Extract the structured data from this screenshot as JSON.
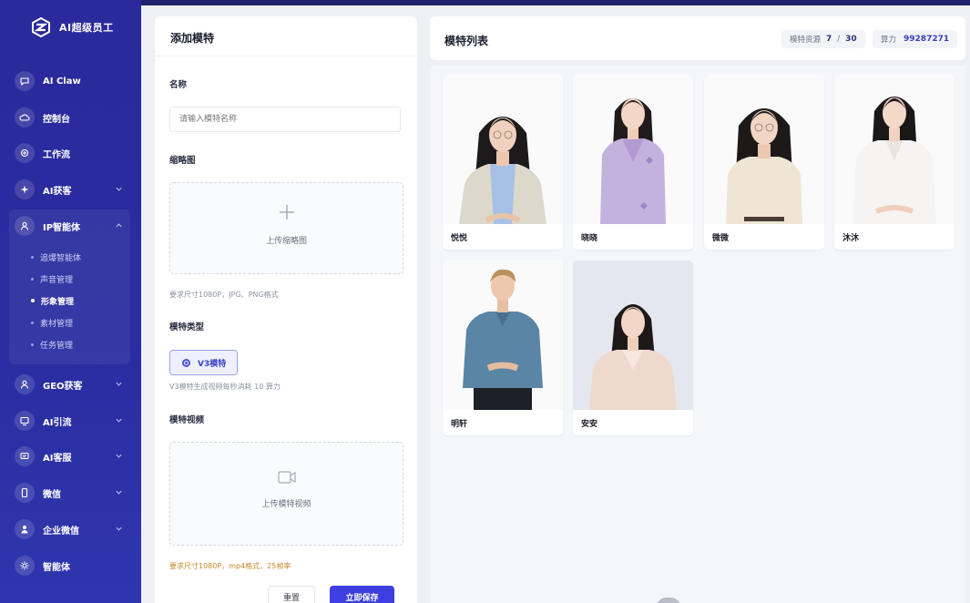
{
  "app": {
    "brand": "AI超级员工"
  },
  "sidebar": {
    "items": [
      {
        "label": "AI Claw",
        "icon": "chat-icon"
      },
      {
        "label": "控制台",
        "icon": "cloud-icon"
      },
      {
        "label": "工作流",
        "icon": "workflow-icon"
      },
      {
        "label": "AI获客",
        "icon": "sparkle-icon"
      },
      {
        "label": "IP智能体",
        "icon": "user-icon"
      },
      {
        "label": "GEO获客",
        "icon": "user-icon"
      },
      {
        "label": "AI引流",
        "icon": "screen-icon"
      },
      {
        "label": "AI客服",
        "icon": "message-icon"
      },
      {
        "label": "微信",
        "icon": "phone-icon"
      },
      {
        "label": "企业微信",
        "icon": "person-icon"
      },
      {
        "label": "智能体",
        "icon": "gear-icon"
      }
    ],
    "sub_items": [
      "追爆智能体",
      "声音管理",
      "形象管理",
      "素材管理",
      "任务管理"
    ],
    "active_sub": "形象管理"
  },
  "form": {
    "title": "添加模特",
    "name_label": "名称",
    "name_placeholder": "请输入模特名称",
    "thumb_label": "缩略图",
    "thumb_upload": "上传缩略图",
    "thumb_hint": "要求尺寸1080P，JPG、PNG格式",
    "type_label": "模特类型",
    "type_option": "V3模特",
    "type_hint": "V3模特生成视频每秒消耗 10 算力",
    "video_label": "模特视频",
    "video_upload": "上传模特视频",
    "video_hint": "要求尺寸1080P，mp4格式，25帧率",
    "reset": "重置",
    "save": "立即保存"
  },
  "list": {
    "title": "模特列表",
    "resource_label": "模特资源",
    "resource_used": "7",
    "resource_sep": "/",
    "resource_total": "30",
    "power_label": "算力",
    "power_value": "99287271",
    "models": [
      {
        "name": "悦悦"
      },
      {
        "name": "晓晓"
      },
      {
        "name": "微微"
      },
      {
        "name": "沐沐"
      },
      {
        "name": "明轩"
      },
      {
        "name": "安安"
      }
    ]
  },
  "colors": {
    "sidebar": "#2b2a9c",
    "accent": "#3d3fe0",
    "warning": "#c58a2a"
  }
}
